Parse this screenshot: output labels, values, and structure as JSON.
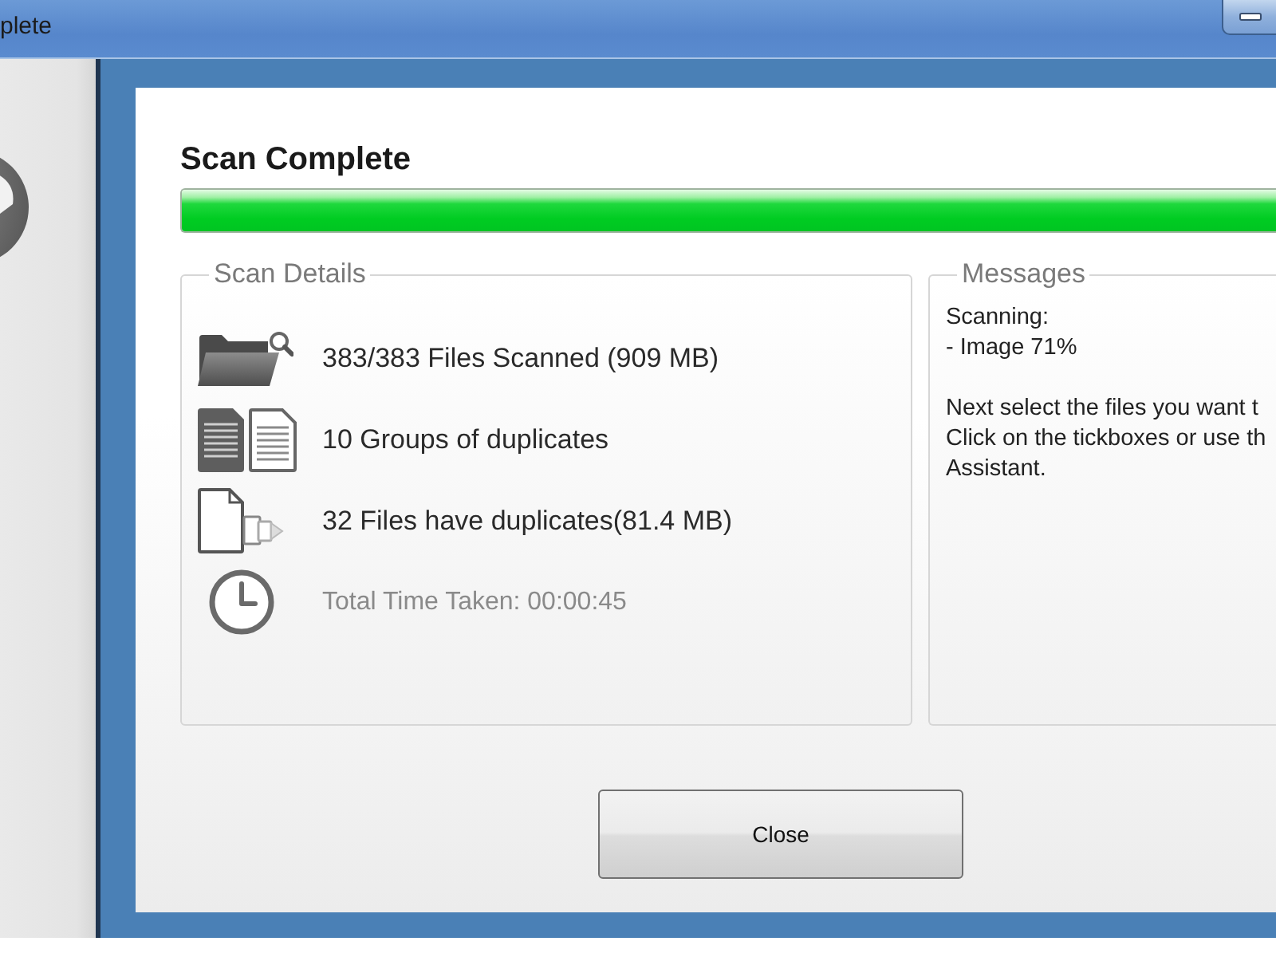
{
  "window": {
    "title": "plete"
  },
  "dialog": {
    "heading": "Scan Complete",
    "progress": {
      "level": 1
    },
    "scan_details": {
      "title": "Scan Details",
      "items": [
        {
          "kind": "folder",
          "text": "383/383 Files Scanned (909 MB)"
        },
        {
          "kind": "groups",
          "text": "10 Groups of duplicates"
        },
        {
          "kind": "copies",
          "text": "32 Files have duplicates(81.4 MB)"
        },
        {
          "kind": "clock",
          "text": "Total Time Taken: 00:00:45"
        }
      ]
    },
    "messages": {
      "title": "Messages",
      "paragraphs": [
        {
          "lines": [
            "Scanning:",
            "- Image 71%"
          ]
        },
        {
          "lines": [
            "Next select the files you want t",
            "Click on the tickboxes or use th",
            "Assistant."
          ]
        }
      ]
    },
    "close_button": "Close"
  }
}
